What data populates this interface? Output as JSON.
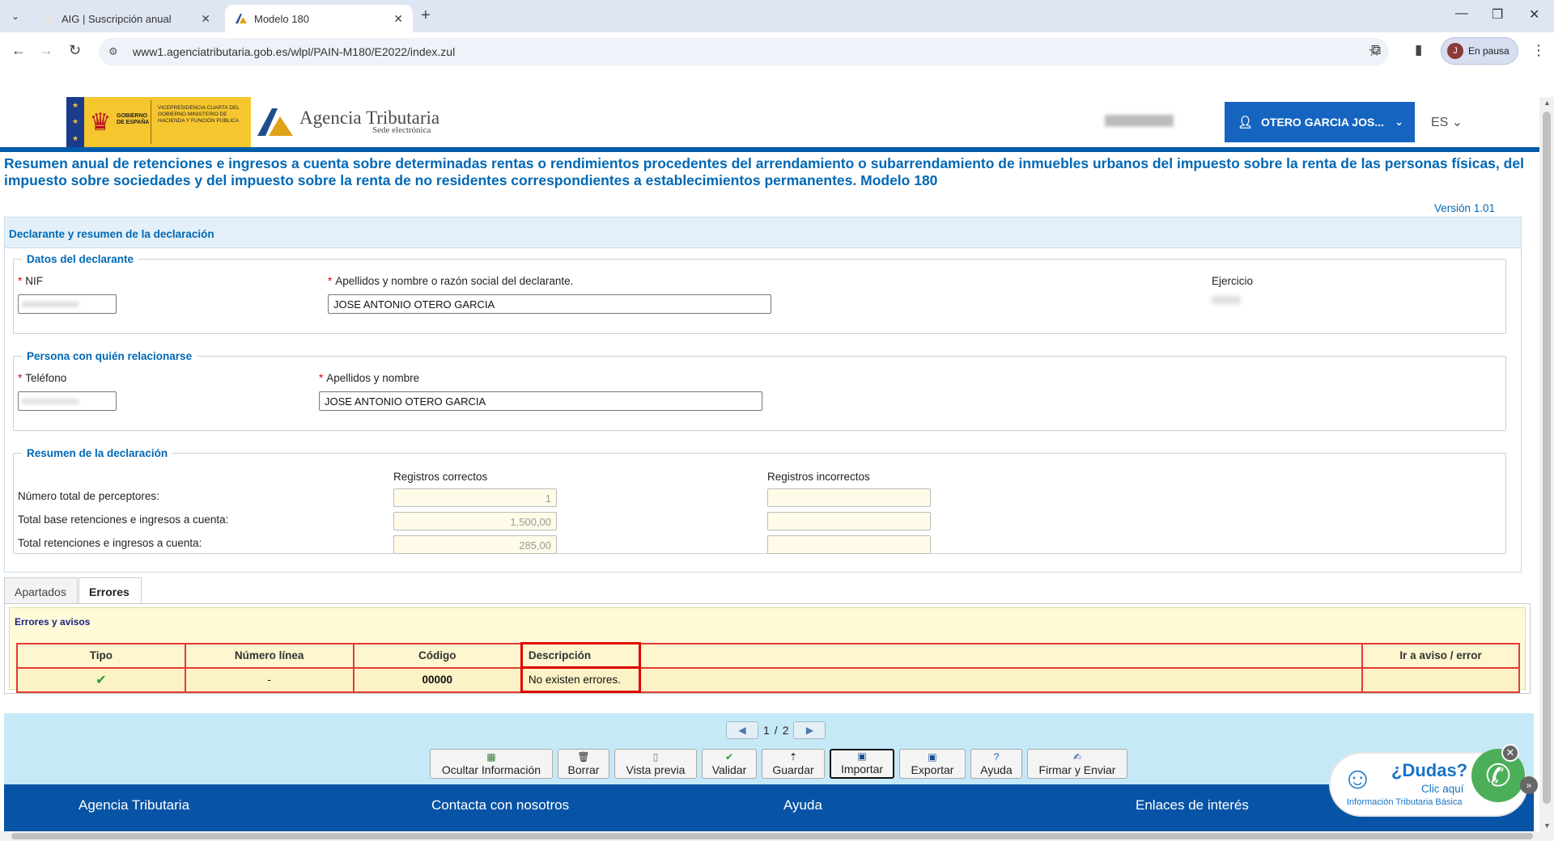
{
  "browser": {
    "tabs": [
      {
        "label": "AIG | Suscripción anual",
        "active": false
      },
      {
        "label": "Modelo 180",
        "active": true
      }
    ],
    "url": "www1.agenciatributaria.gob.es/wlpl/PAIN-M180/E2022/index.zul",
    "profile_initial": "J",
    "profile_label": "En pausa"
  },
  "header": {
    "gov_gobierno": "GOBIERNO DE ESPAÑA",
    "gov_ministerio": "VICEPRESIDENCIA CUARTA DEL GOBIERNO MINISTERIO DE HACIENDA Y FUNCIÓN PÚBLICA",
    "agency_name": "Agencia Tributaria",
    "agency_sub": "Sede electrónica",
    "user_label": "OTERO GARCIA JOS...",
    "language": "ES"
  },
  "page": {
    "title": "Resumen anual de retenciones e ingresos a cuenta sobre determinadas rentas o rendimientos procedentes del arrendamiento o subarrendamiento de inmuebles urbanos del impuesto sobre la renta de las personas físicas, del impuesto sobre sociedades y del impuesto sobre la renta de no residentes correspondientes a establecimientos permanentes. Modelo 180",
    "version": "Versión 1.01"
  },
  "panel": {
    "title": "Declarante y resumen de la declaración",
    "declarante": {
      "legend": "Datos del declarante",
      "nif_label": "NIF",
      "nombre_label": "Apellidos y nombre o razón social del declarante.",
      "nombre_value": "JOSE ANTONIO OTERO GARCIA",
      "ejercicio_label": "Ejercicio"
    },
    "contacto": {
      "legend": "Persona con quién relacionarse",
      "telefono_label": "Teléfono",
      "nombre_label": "Apellidos y nombre",
      "nombre_value": "JOSE ANTONIO OTERO GARCIA"
    },
    "resumen": {
      "legend": "Resumen de la declaración",
      "col_correctos": "Registros correctos",
      "col_incorrectos": "Registros incorrectos",
      "rows": [
        {
          "label": "Número total de perceptores:",
          "correctos": "1",
          "incorrectos": ""
        },
        {
          "label": "Total base retenciones e ingresos a cuenta:",
          "correctos": "1.500,00",
          "incorrectos": ""
        },
        {
          "label": "Total retenciones e ingresos a cuenta:",
          "correctos": "285,00",
          "incorrectos": ""
        }
      ]
    }
  },
  "tabs": [
    {
      "label": "Apartados",
      "active": false
    },
    {
      "label": "Errores",
      "active": true
    }
  ],
  "errores": {
    "title": "Errores y avisos",
    "columns": [
      "Tipo",
      "Número línea",
      "Código",
      "Descripción",
      "",
      "Ir a aviso / error"
    ],
    "row": {
      "tipo_icon": "check-icon",
      "linea": "-",
      "codigo": "00000",
      "descripcion": "No existen errores."
    }
  },
  "pager": {
    "current": "1",
    "separator": "/",
    "total": "2"
  },
  "actions": [
    {
      "label": "Ocultar Información",
      "icon": "table-icon"
    },
    {
      "label": "Borrar",
      "icon": "trash-icon"
    },
    {
      "label": "Vista previa",
      "icon": "document-icon"
    },
    {
      "label": "Validar",
      "icon": "check-icon"
    },
    {
      "label": "Guardar",
      "icon": "save-icon"
    },
    {
      "label": "Importar",
      "icon": "import-icon"
    },
    {
      "label": "Exportar",
      "icon": "export-icon"
    },
    {
      "label": "Ayuda",
      "icon": "help-icon"
    },
    {
      "label": "Firmar y Enviar",
      "icon": "sign-icon"
    }
  ],
  "footer": {
    "links": [
      "Agencia Tributaria",
      "Contacta con nosotros",
      "Ayuda",
      "Enlaces de interés"
    ]
  },
  "dudas": {
    "question": "¿Dudas?",
    "cta": "Clic aquí",
    "info": "Información Tributaria Básica"
  }
}
